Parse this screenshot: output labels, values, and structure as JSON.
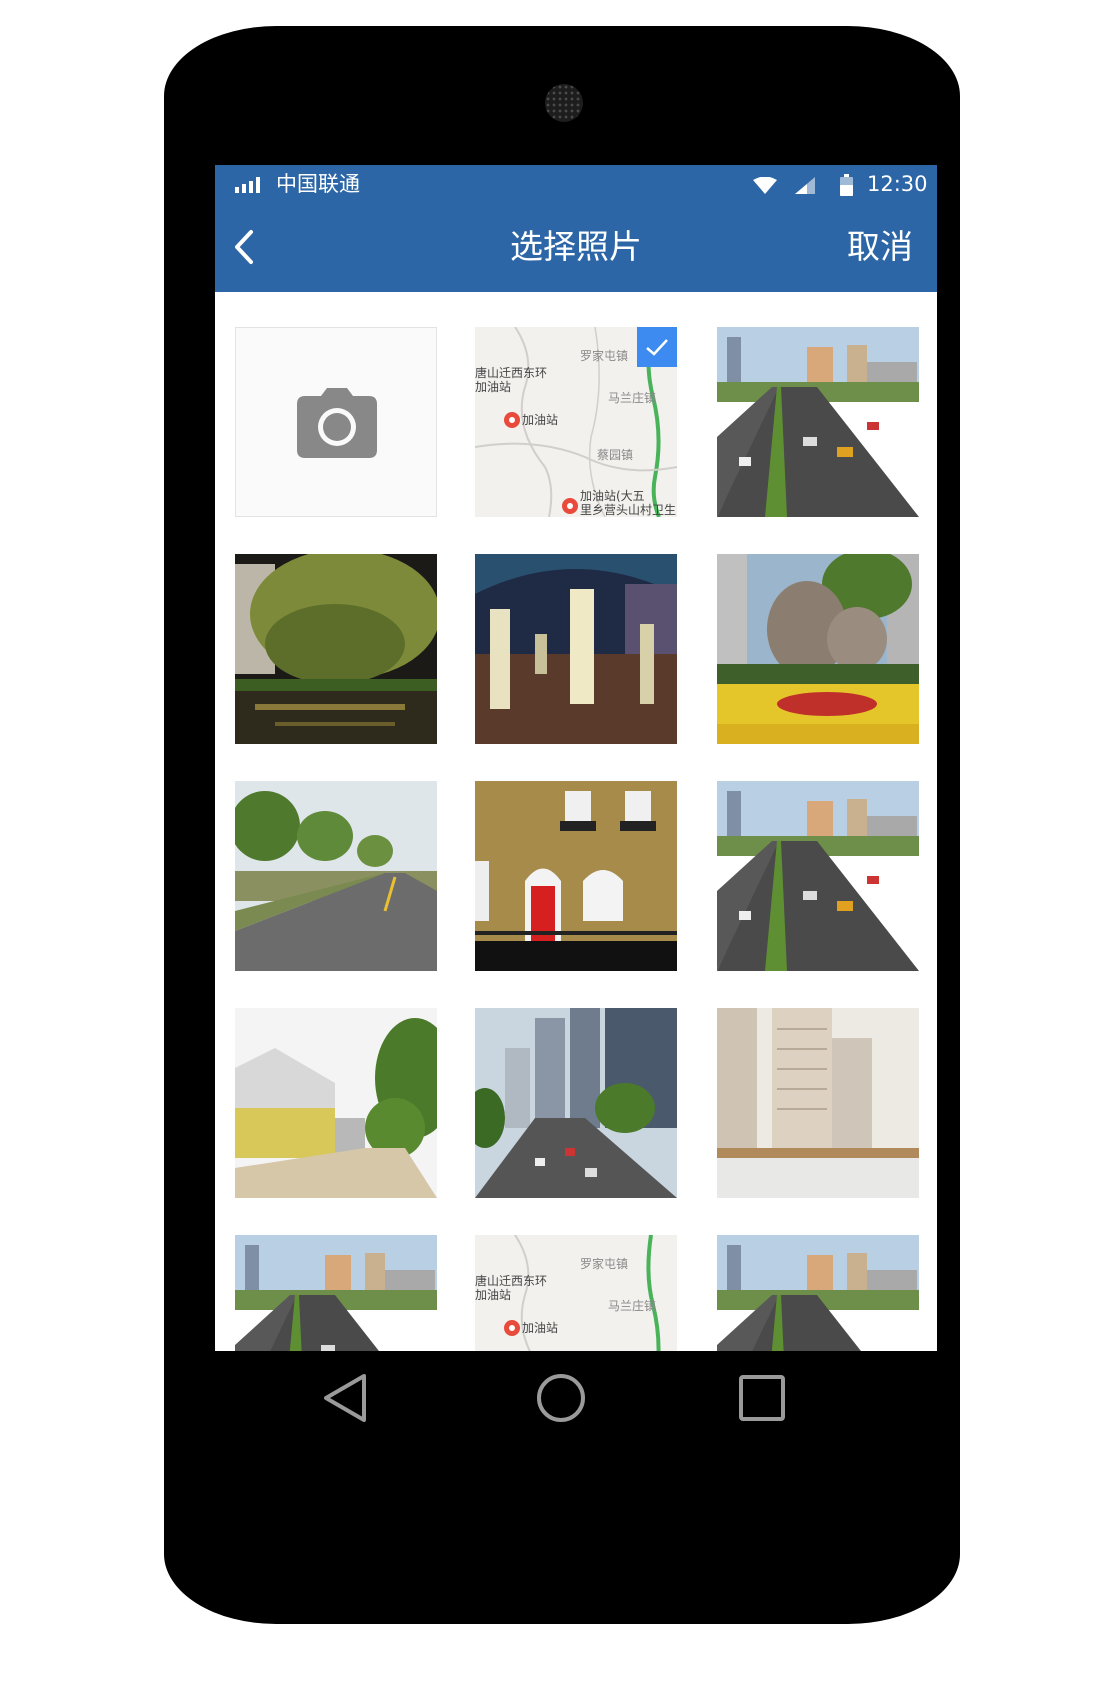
{
  "status_bar": {
    "carrier": "中国联通",
    "time": "12:30",
    "icons": [
      "signal-bars-icon",
      "wifi-icon",
      "cellular-signal-icon",
      "battery-icon"
    ]
  },
  "app_bar": {
    "title": "选择照片",
    "cancel_label": "取消",
    "back_icon": "chevron-left-icon"
  },
  "grid": {
    "camera_tile_icon": "camera-icon",
    "selected_badge_icon": "checkmark-icon",
    "photos": [
      {
        "subject": "map",
        "selected": true
      },
      {
        "subject": "city road",
        "selected": false
      },
      {
        "subject": "willow canal at night",
        "selected": false
      },
      {
        "subject": "lit plaza at night",
        "selected": false
      },
      {
        "subject": "rock monument with flowers",
        "selected": false
      },
      {
        "subject": "tree lined road",
        "selected": false
      },
      {
        "subject": "brick house red door",
        "selected": false
      },
      {
        "subject": "city road",
        "selected": false
      },
      {
        "subject": "village street",
        "selected": false
      },
      {
        "subject": "high rise avenue",
        "selected": false
      },
      {
        "subject": "apartment rendering",
        "selected": false
      },
      {
        "subject": "city road",
        "selected": false
      },
      {
        "subject": "map",
        "selected": false
      },
      {
        "subject": "city road",
        "selected": false
      }
    ],
    "map_labels": {
      "label_1": "罗家屯镇",
      "label_2": "唐山迁西东环",
      "label_3": "加油站",
      "label_4": "马兰庄镇",
      "label_5": "加油站",
      "label_6": "蔡园镇",
      "label_7": "加油站(大五",
      "label_8": "里乡营头山村卫生"
    }
  },
  "nav_bar": {
    "icons": [
      "back-triangle-icon",
      "home-circle-icon",
      "recents-square-icon"
    ]
  },
  "colors": {
    "primary": "#2c66a6",
    "check_badge": "#3d8af0",
    "camera_icon": "#888888",
    "device_frame": "#000000"
  }
}
